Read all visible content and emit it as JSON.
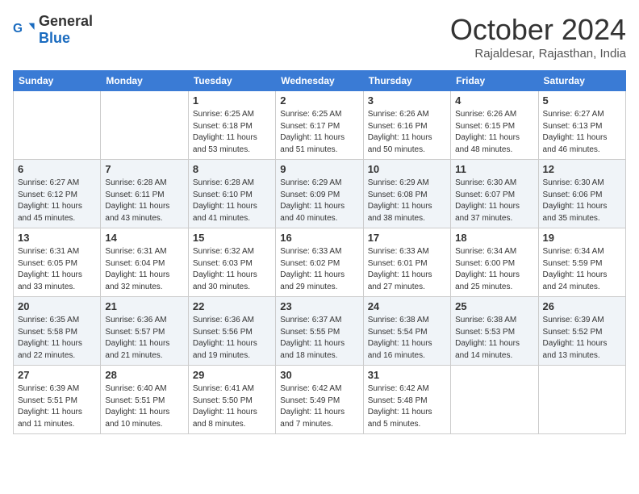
{
  "header": {
    "logo_general": "General",
    "logo_blue": "Blue",
    "month_title": "October 2024",
    "location": "Rajaldesar, Rajasthan, India"
  },
  "weekdays": [
    "Sunday",
    "Monday",
    "Tuesday",
    "Wednesday",
    "Thursday",
    "Friday",
    "Saturday"
  ],
  "weeks": [
    [
      {
        "day": "",
        "info": ""
      },
      {
        "day": "",
        "info": ""
      },
      {
        "day": "1",
        "info": "Sunrise: 6:25 AM\nSunset: 6:18 PM\nDaylight: 11 hours and 53 minutes."
      },
      {
        "day": "2",
        "info": "Sunrise: 6:25 AM\nSunset: 6:17 PM\nDaylight: 11 hours and 51 minutes."
      },
      {
        "day": "3",
        "info": "Sunrise: 6:26 AM\nSunset: 6:16 PM\nDaylight: 11 hours and 50 minutes."
      },
      {
        "day": "4",
        "info": "Sunrise: 6:26 AM\nSunset: 6:15 PM\nDaylight: 11 hours and 48 minutes."
      },
      {
        "day": "5",
        "info": "Sunrise: 6:27 AM\nSunset: 6:13 PM\nDaylight: 11 hours and 46 minutes."
      }
    ],
    [
      {
        "day": "6",
        "info": "Sunrise: 6:27 AM\nSunset: 6:12 PM\nDaylight: 11 hours and 45 minutes."
      },
      {
        "day": "7",
        "info": "Sunrise: 6:28 AM\nSunset: 6:11 PM\nDaylight: 11 hours and 43 minutes."
      },
      {
        "day": "8",
        "info": "Sunrise: 6:28 AM\nSunset: 6:10 PM\nDaylight: 11 hours and 41 minutes."
      },
      {
        "day": "9",
        "info": "Sunrise: 6:29 AM\nSunset: 6:09 PM\nDaylight: 11 hours and 40 minutes."
      },
      {
        "day": "10",
        "info": "Sunrise: 6:29 AM\nSunset: 6:08 PM\nDaylight: 11 hours and 38 minutes."
      },
      {
        "day": "11",
        "info": "Sunrise: 6:30 AM\nSunset: 6:07 PM\nDaylight: 11 hours and 37 minutes."
      },
      {
        "day": "12",
        "info": "Sunrise: 6:30 AM\nSunset: 6:06 PM\nDaylight: 11 hours and 35 minutes."
      }
    ],
    [
      {
        "day": "13",
        "info": "Sunrise: 6:31 AM\nSunset: 6:05 PM\nDaylight: 11 hours and 33 minutes."
      },
      {
        "day": "14",
        "info": "Sunrise: 6:31 AM\nSunset: 6:04 PM\nDaylight: 11 hours and 32 minutes."
      },
      {
        "day": "15",
        "info": "Sunrise: 6:32 AM\nSunset: 6:03 PM\nDaylight: 11 hours and 30 minutes."
      },
      {
        "day": "16",
        "info": "Sunrise: 6:33 AM\nSunset: 6:02 PM\nDaylight: 11 hours and 29 minutes."
      },
      {
        "day": "17",
        "info": "Sunrise: 6:33 AM\nSunset: 6:01 PM\nDaylight: 11 hours and 27 minutes."
      },
      {
        "day": "18",
        "info": "Sunrise: 6:34 AM\nSunset: 6:00 PM\nDaylight: 11 hours and 25 minutes."
      },
      {
        "day": "19",
        "info": "Sunrise: 6:34 AM\nSunset: 5:59 PM\nDaylight: 11 hours and 24 minutes."
      }
    ],
    [
      {
        "day": "20",
        "info": "Sunrise: 6:35 AM\nSunset: 5:58 PM\nDaylight: 11 hours and 22 minutes."
      },
      {
        "day": "21",
        "info": "Sunrise: 6:36 AM\nSunset: 5:57 PM\nDaylight: 11 hours and 21 minutes."
      },
      {
        "day": "22",
        "info": "Sunrise: 6:36 AM\nSunset: 5:56 PM\nDaylight: 11 hours and 19 minutes."
      },
      {
        "day": "23",
        "info": "Sunrise: 6:37 AM\nSunset: 5:55 PM\nDaylight: 11 hours and 18 minutes."
      },
      {
        "day": "24",
        "info": "Sunrise: 6:38 AM\nSunset: 5:54 PM\nDaylight: 11 hours and 16 minutes."
      },
      {
        "day": "25",
        "info": "Sunrise: 6:38 AM\nSunset: 5:53 PM\nDaylight: 11 hours and 14 minutes."
      },
      {
        "day": "26",
        "info": "Sunrise: 6:39 AM\nSunset: 5:52 PM\nDaylight: 11 hours and 13 minutes."
      }
    ],
    [
      {
        "day": "27",
        "info": "Sunrise: 6:39 AM\nSunset: 5:51 PM\nDaylight: 11 hours and 11 minutes."
      },
      {
        "day": "28",
        "info": "Sunrise: 6:40 AM\nSunset: 5:51 PM\nDaylight: 11 hours and 10 minutes."
      },
      {
        "day": "29",
        "info": "Sunrise: 6:41 AM\nSunset: 5:50 PM\nDaylight: 11 hours and 8 minutes."
      },
      {
        "day": "30",
        "info": "Sunrise: 6:42 AM\nSunset: 5:49 PM\nDaylight: 11 hours and 7 minutes."
      },
      {
        "day": "31",
        "info": "Sunrise: 6:42 AM\nSunset: 5:48 PM\nDaylight: 11 hours and 5 minutes."
      },
      {
        "day": "",
        "info": ""
      },
      {
        "day": "",
        "info": ""
      }
    ]
  ]
}
